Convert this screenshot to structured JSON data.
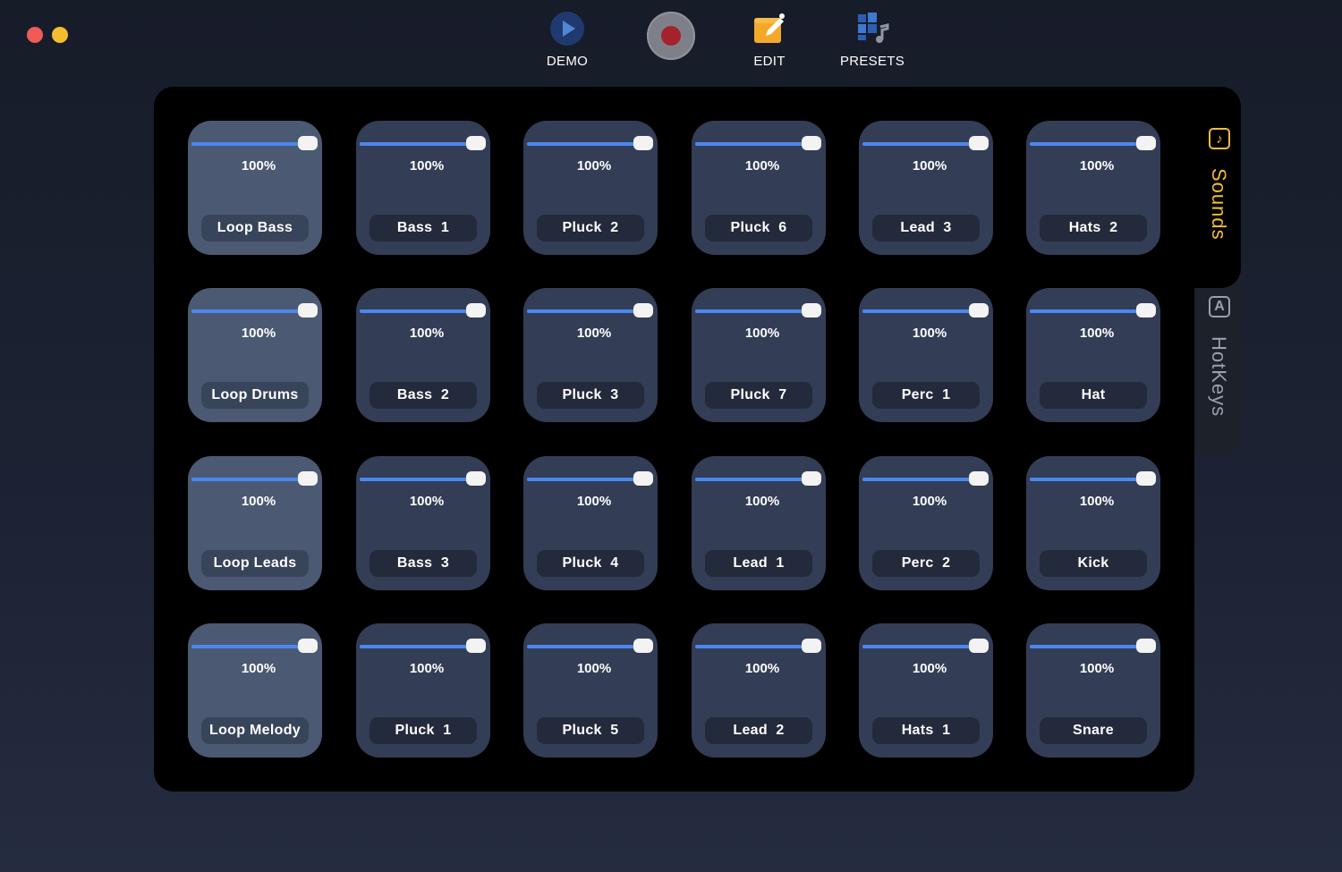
{
  "toolbar": {
    "demo_label": "DEMO",
    "edit_label": "EDIT",
    "presets_label": "PRESETS"
  },
  "tabs": {
    "sounds": {
      "label": "Sounds",
      "icon": "music-note-icon",
      "active": true
    },
    "hotkeys": {
      "label": "HotKeys",
      "icon": "keyboard-key-icon",
      "active": false
    }
  },
  "colors": {
    "accent": "#f4bc38",
    "slider": "#4a88f0",
    "pad": "#333d56",
    "loop_pad": "#4b5972",
    "record": "#a3222b"
  },
  "pads": [
    {
      "name": "Loop Bass",
      "volume": "100%",
      "level": 1.0,
      "loop": true
    },
    {
      "name": "Bass  1",
      "volume": "100%",
      "level": 1.0,
      "loop": false
    },
    {
      "name": "Pluck  2",
      "volume": "100%",
      "level": 1.0,
      "loop": false
    },
    {
      "name": "Pluck  6",
      "volume": "100%",
      "level": 1.0,
      "loop": false
    },
    {
      "name": "Lead  3",
      "volume": "100%",
      "level": 1.0,
      "loop": false
    },
    {
      "name": "Hats  2",
      "volume": "100%",
      "level": 1.0,
      "loop": false
    },
    {
      "name": "Loop Drums",
      "volume": "100%",
      "level": 1.0,
      "loop": true
    },
    {
      "name": "Bass  2",
      "volume": "100%",
      "level": 1.0,
      "loop": false
    },
    {
      "name": "Pluck  3",
      "volume": "100%",
      "level": 1.0,
      "loop": false
    },
    {
      "name": "Pluck  7",
      "volume": "100%",
      "level": 1.0,
      "loop": false
    },
    {
      "name": "Perc  1",
      "volume": "100%",
      "level": 1.0,
      "loop": false
    },
    {
      "name": "Hat",
      "volume": "100%",
      "level": 1.0,
      "loop": false
    },
    {
      "name": "Loop Leads",
      "volume": "100%",
      "level": 1.0,
      "loop": true
    },
    {
      "name": "Bass  3",
      "volume": "100%",
      "level": 1.0,
      "loop": false
    },
    {
      "name": "Pluck  4",
      "volume": "100%",
      "level": 1.0,
      "loop": false
    },
    {
      "name": "Lead  1",
      "volume": "100%",
      "level": 1.0,
      "loop": false
    },
    {
      "name": "Perc  2",
      "volume": "100%",
      "level": 1.0,
      "loop": false
    },
    {
      "name": "Kick",
      "volume": "100%",
      "level": 1.0,
      "loop": false
    },
    {
      "name": "Loop Melody",
      "volume": "100%",
      "level": 1.0,
      "loop": true
    },
    {
      "name": "Pluck  1",
      "volume": "100%",
      "level": 1.0,
      "loop": false
    },
    {
      "name": "Pluck  5",
      "volume": "100%",
      "level": 1.0,
      "loop": false
    },
    {
      "name": "Lead  2",
      "volume": "100%",
      "level": 1.0,
      "loop": false
    },
    {
      "name": "Hats  1",
      "volume": "100%",
      "level": 1.0,
      "loop": false
    },
    {
      "name": "Snare",
      "volume": "100%",
      "level": 1.0,
      "loop": false
    }
  ]
}
